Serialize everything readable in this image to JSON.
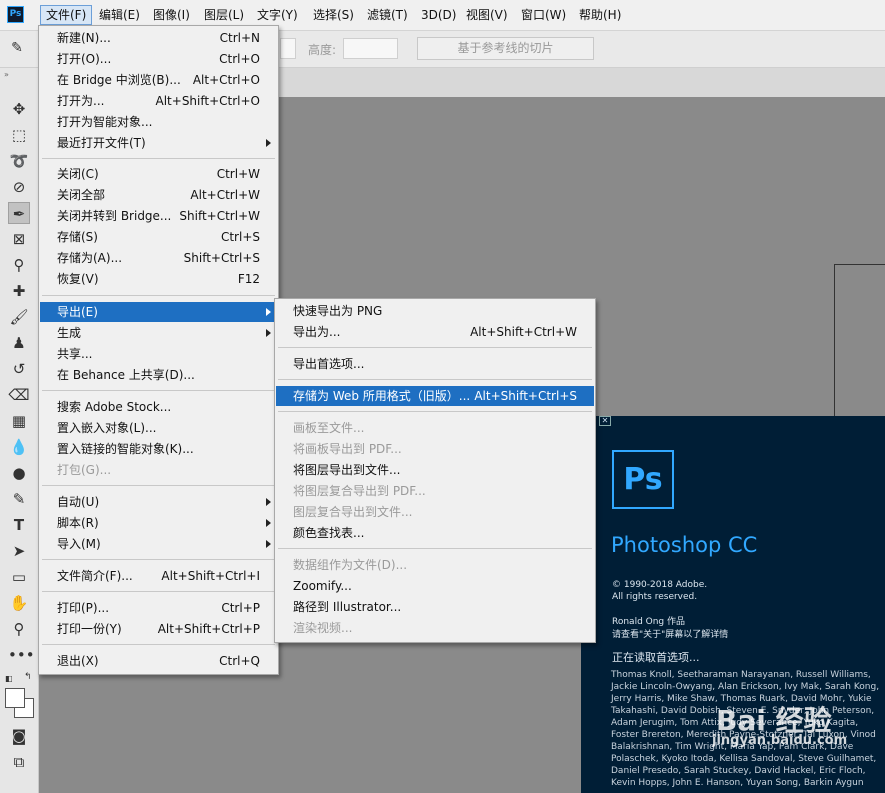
{
  "menubar": {
    "logo": "Ps",
    "items": [
      "文件(F)",
      "编辑(E)",
      "图像(I)",
      "图层(L)",
      "文字(Y)",
      "选择(S)",
      "滤镜(T)",
      "3D(D)",
      "视图(V)",
      "窗口(W)",
      "帮助(H)"
    ]
  },
  "options": {
    "height_label": "高度:",
    "slice_button": "基于参考线的切片"
  },
  "file_menu": {
    "items": [
      {
        "label": "新建(N)...",
        "shortcut": "Ctrl+N"
      },
      {
        "label": "打开(O)...",
        "shortcut": "Ctrl+O"
      },
      {
        "label": "在 Bridge 中浏览(B)...",
        "shortcut": "Alt+Ctrl+O"
      },
      {
        "label": "打开为...",
        "shortcut": "Alt+Shift+Ctrl+O"
      },
      {
        "label": "打开为智能对象...",
        "shortcut": ""
      },
      {
        "label": "最近打开文件(T)",
        "shortcut": ""
      },
      {
        "label": "关闭(C)",
        "shortcut": "Ctrl+W"
      },
      {
        "label": "关闭全部",
        "shortcut": "Alt+Ctrl+W"
      },
      {
        "label": "关闭并转到 Bridge...",
        "shortcut": "Shift+Ctrl+W"
      },
      {
        "label": "存储(S)",
        "shortcut": "Ctrl+S"
      },
      {
        "label": "存储为(A)...",
        "shortcut": "Shift+Ctrl+S"
      },
      {
        "label": "恢复(V)",
        "shortcut": "F12"
      },
      {
        "label": "导出(E)",
        "shortcut": ""
      },
      {
        "label": "生成",
        "shortcut": ""
      },
      {
        "label": "共享...",
        "shortcut": ""
      },
      {
        "label": "在 Behance 上共享(D)...",
        "shortcut": ""
      },
      {
        "label": "搜索 Adobe Stock...",
        "shortcut": ""
      },
      {
        "label": "置入嵌入对象(L)...",
        "shortcut": ""
      },
      {
        "label": "置入链接的智能对象(K)...",
        "shortcut": ""
      },
      {
        "label": "打包(G)...",
        "shortcut": ""
      },
      {
        "label": "自动(U)",
        "shortcut": ""
      },
      {
        "label": "脚本(R)",
        "shortcut": ""
      },
      {
        "label": "导入(M)",
        "shortcut": ""
      },
      {
        "label": "文件简介(F)...",
        "shortcut": "Alt+Shift+Ctrl+I"
      },
      {
        "label": "打印(P)...",
        "shortcut": "Ctrl+P"
      },
      {
        "label": "打印一份(Y)",
        "shortcut": "Alt+Shift+Ctrl+P"
      },
      {
        "label": "退出(X)",
        "shortcut": "Ctrl+Q"
      }
    ]
  },
  "export_menu": {
    "items": [
      {
        "label": "快速导出为 PNG",
        "shortcut": ""
      },
      {
        "label": "导出为...",
        "shortcut": "Alt+Shift+Ctrl+W"
      },
      {
        "label": "导出首选项...",
        "shortcut": ""
      },
      {
        "label": "存储为 Web 所用格式（旧版）...",
        "shortcut": "Alt+Shift+Ctrl+S"
      },
      {
        "label": "画板至文件...",
        "shortcut": ""
      },
      {
        "label": "将画板导出到 PDF...",
        "shortcut": ""
      },
      {
        "label": "将图层导出到文件...",
        "shortcut": ""
      },
      {
        "label": "将图层复合导出到 PDF...",
        "shortcut": ""
      },
      {
        "label": "图层复合导出到文件...",
        "shortcut": ""
      },
      {
        "label": "颜色查找表...",
        "shortcut": ""
      },
      {
        "label": "数据组作为文件(D)...",
        "shortcut": ""
      },
      {
        "label": "Zoomify...",
        "shortcut": ""
      },
      {
        "label": "路径到 Illustrator...",
        "shortcut": ""
      },
      {
        "label": "渲染视频...",
        "shortcut": ""
      }
    ]
  },
  "splash": {
    "logo": "Ps",
    "title": "Photoshop CC",
    "copyright_1": "© 1990-2018 Adobe.",
    "copyright_2": "All rights reserved.",
    "author": "Ronald Ong 作品",
    "about_hint": "请查看\"关于\"屏幕以了解详情",
    "status": "正在读取首选项...",
    "credits": "Thomas Knoll, Seetharaman Narayanan, Russell Williams, Jackie Lincoln-Owyang, Alan Erickson, Ivy Mak, Sarah Kong, Jerry Harris, Mike Shaw, Thomas Ruark, David Mohr, Yukie Takahashi, David Dobish, Steven E. Snyder, John Peterson, Adam Jerugim, Tom Attix, Judy Severance, Yuko Kagita, Foster Brereton, Meredith Payne-Stotzner, Tai Luxon, Vinod Balakrishnan, Tim Wright, Maria Yap, Pam Clark, Dave Polaschek, Kyoko Itoda, Kellisa Sandoval, Steve Guilhamet, Daniel Presedo, Sarah Stuckey, David Hackel, Eric Floch, Kevin Hopps, John E. Hanson, Yuyan Song, Barkin Aygun"
  },
  "watermark": {
    "brand": "Bai 经验",
    "url": "jingyan.baidu.com"
  }
}
